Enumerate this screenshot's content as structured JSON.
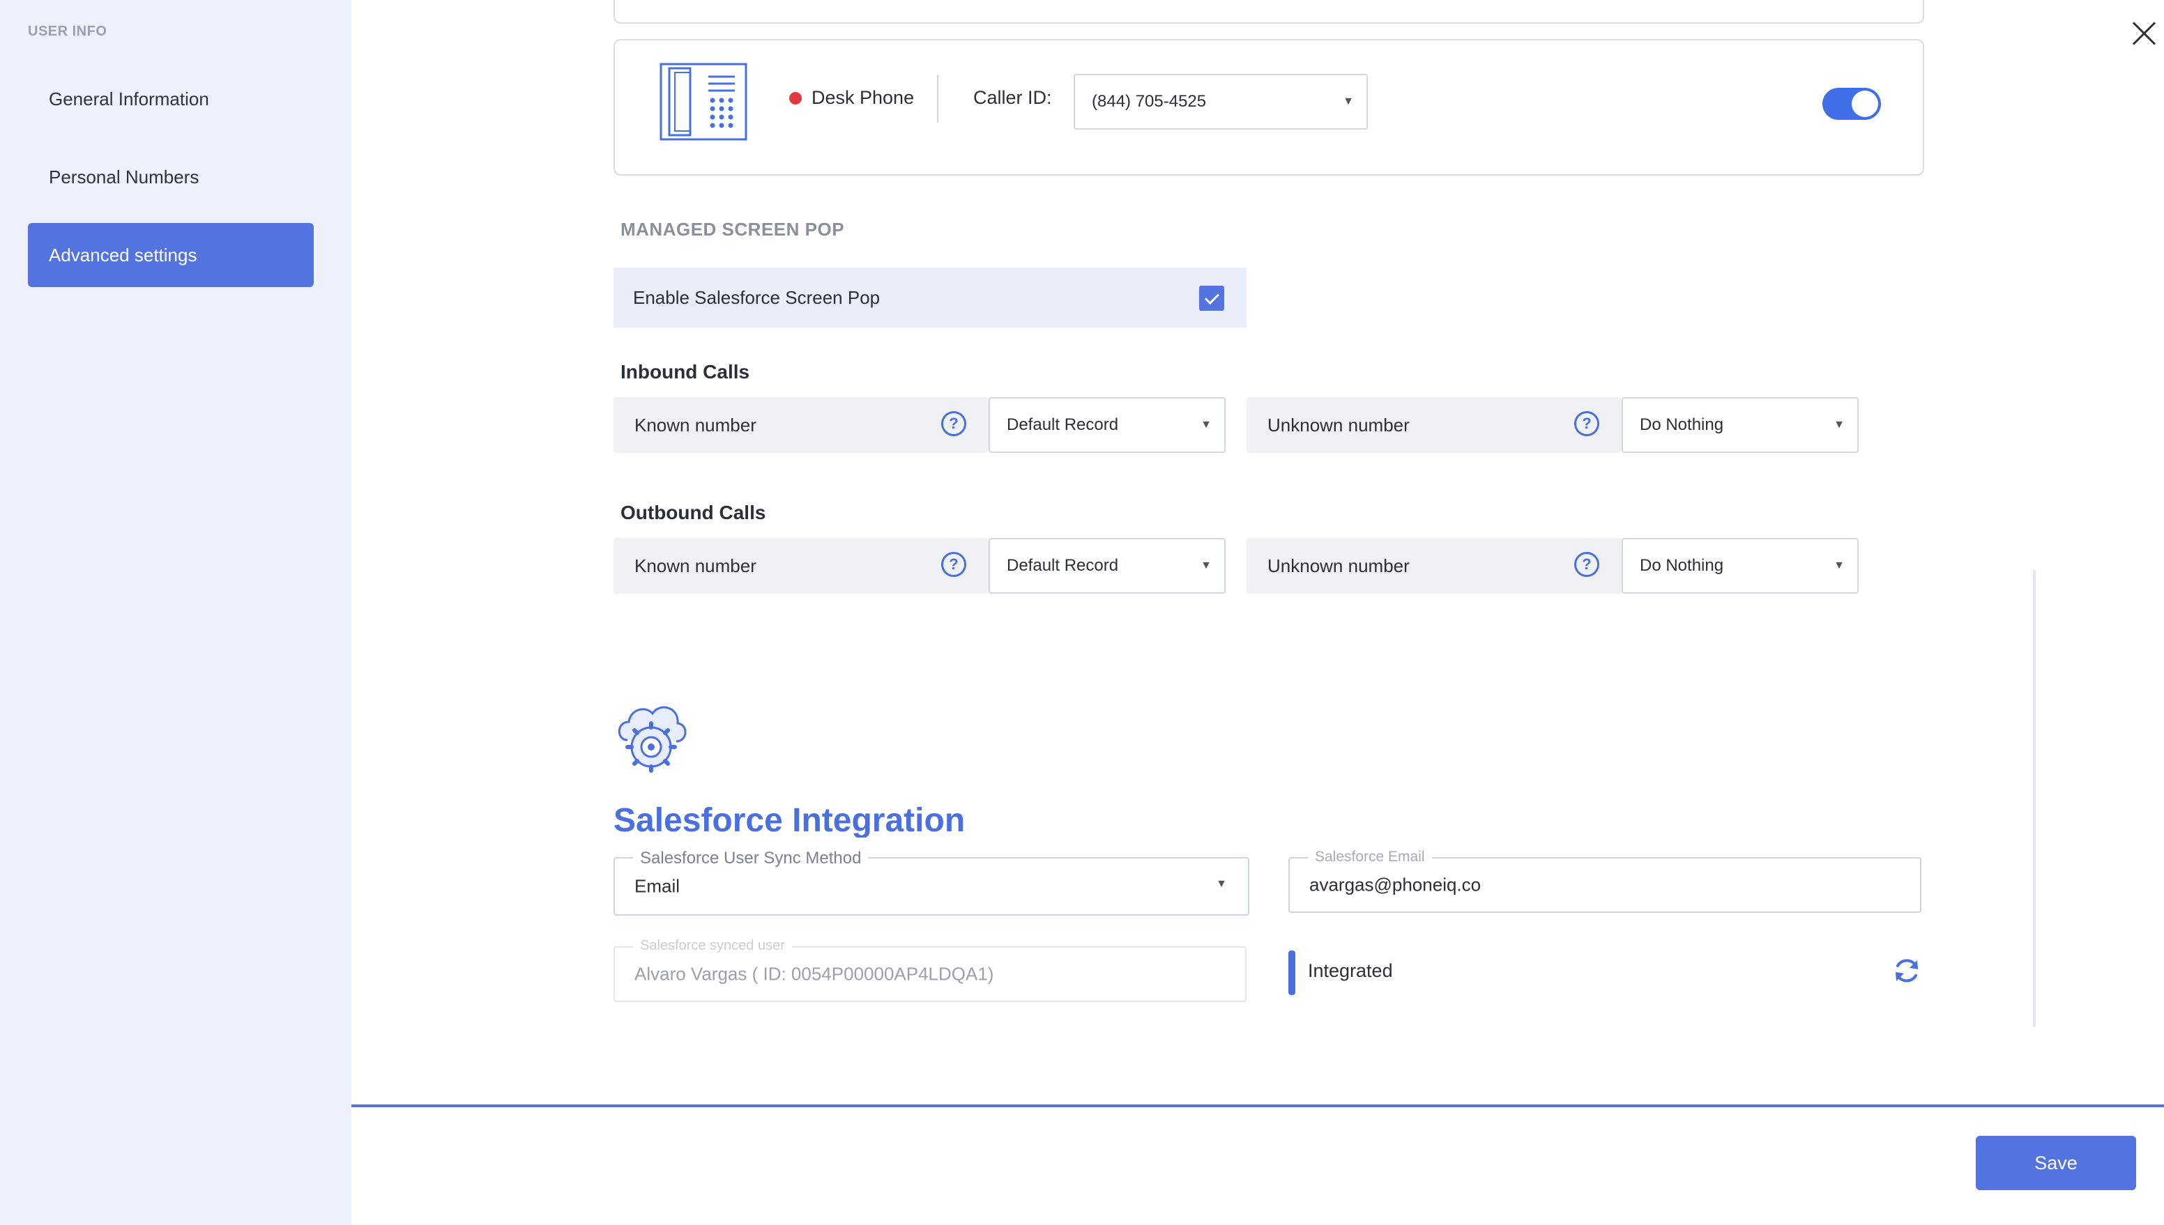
{
  "sidebar": {
    "section_label": "USER INFO",
    "items": [
      {
        "label": "General Information",
        "active": false
      },
      {
        "label": "Personal Numbers",
        "active": false
      },
      {
        "label": "Advanced settings",
        "active": true
      }
    ]
  },
  "device": {
    "icon": "desk-phone-icon",
    "name": "Desk Phone",
    "status_color": "#e0393e",
    "caller_id_label": "Caller ID:",
    "caller_id_value": "(844) 705-4525",
    "enabled": true
  },
  "screen_pop": {
    "heading": "MANAGED SCREEN POP",
    "enable_label": "Enable Salesforce Screen Pop",
    "enabled": true,
    "inbound": {
      "heading": "Inbound Calls",
      "known_label": "Known number",
      "known_value": "Default Record",
      "unknown_label": "Unknown number",
      "unknown_value": "Do Nothing"
    },
    "outbound": {
      "heading": "Outbound Calls",
      "known_label": "Known number",
      "known_value": "Default Record",
      "unknown_label": "Unknown number",
      "unknown_value": "Do Nothing"
    }
  },
  "salesforce": {
    "icon": "cloud-gear-icon",
    "title": "Salesforce Integration",
    "sync_method_label": "Salesforce User Sync Method",
    "sync_method_value": "Email",
    "email_label": "Salesforce Email",
    "email_value": "avargas@phoneiq.co",
    "synced_user_label": "Salesforce synced user",
    "synced_user_value": "Alvaro Vargas ( ID: 0054P00000AP4LDQA1)",
    "status": "Integrated",
    "refresh_icon": "refresh-icon"
  },
  "footer": {
    "save_label": "Save"
  },
  "colors": {
    "accent": "#5273e0",
    "sidebar_bg": "#eef1fb"
  }
}
